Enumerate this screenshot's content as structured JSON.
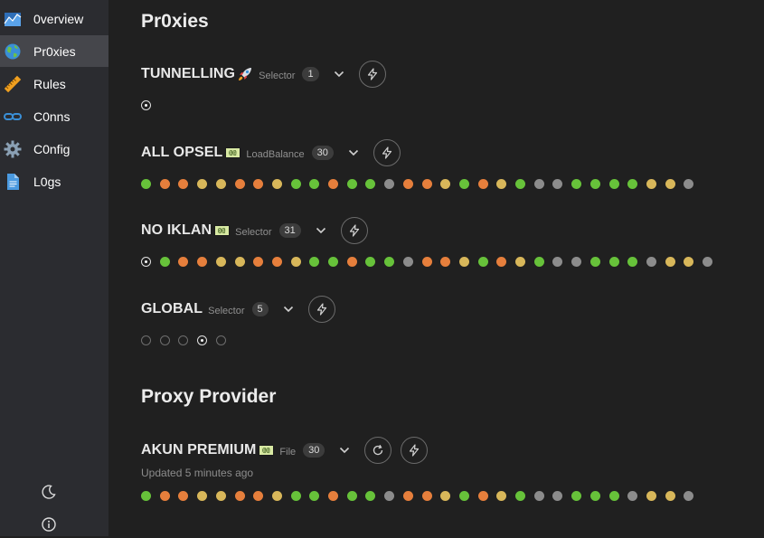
{
  "colors": {
    "green": "#67c23a",
    "orange": "#e67f3c",
    "yellow": "#d8b75a",
    "gray": "#8c8c8c",
    "sidebar_active": "#45464b"
  },
  "sidebar": {
    "items": [
      {
        "label": "0verview",
        "icon": "chart-icon"
      },
      {
        "label": "Pr0xies",
        "icon": "globe-icon",
        "active": true
      },
      {
        "label": "Rules",
        "icon": "ruler-icon"
      },
      {
        "label": "C0nns",
        "icon": "link-icon"
      },
      {
        "label": "C0nfig",
        "icon": "gear-icon"
      },
      {
        "label": "L0gs",
        "icon": "document-icon"
      }
    ],
    "bottom": [
      "moon-icon",
      "info-icon"
    ]
  },
  "main": {
    "title": "Pr0xies",
    "groups": [
      {
        "name": "TUNNELLING",
        "emoji": "rocket-icon",
        "type": "Selector",
        "count": "1",
        "dots": [
          "selected"
        ]
      },
      {
        "name": "ALL OPSEL",
        "emoji": "flag-icon",
        "type": "LoadBalance",
        "count": "30",
        "dots": [
          "g",
          "o",
          "o",
          "y",
          "y",
          "o",
          "o",
          "y",
          "g",
          "g",
          "o",
          "g",
          "g",
          "x",
          "o",
          "o",
          "y",
          "g",
          "o",
          "y",
          "g",
          "x",
          "x",
          "g",
          "g",
          "g",
          "g",
          "y",
          "y",
          "x"
        ]
      },
      {
        "name": "NO IKLAN",
        "emoji": "flag-icon",
        "type": "Selector",
        "count": "31",
        "dots": [
          "selected",
          "g",
          "o",
          "o",
          "y",
          "y",
          "o",
          "o",
          "y",
          "g",
          "g",
          "o",
          "g",
          "g",
          "x",
          "o",
          "o",
          "y",
          "g",
          "o",
          "y",
          "g",
          "x",
          "x",
          "g",
          "g",
          "g",
          "x",
          "y",
          "y",
          "x"
        ]
      },
      {
        "name": "GLOBAL",
        "emoji": "",
        "type": "Selector",
        "count": "5",
        "dots": [
          "empty",
          "empty",
          "empty",
          "selected",
          "empty"
        ]
      }
    ],
    "provider_title": "Proxy Provider",
    "providers": [
      {
        "name": "AKUN PREMIUM",
        "emoji": "flag-icon",
        "type": "File",
        "count": "30",
        "updated": "Updated 5 minutes ago",
        "dots": [
          "g",
          "o",
          "o",
          "y",
          "y",
          "o",
          "o",
          "y",
          "g",
          "g",
          "o",
          "g",
          "g",
          "x",
          "o",
          "o",
          "y",
          "g",
          "o",
          "y",
          "g",
          "x",
          "x",
          "g",
          "g",
          "g",
          "x",
          "y",
          "y",
          "x"
        ]
      }
    ]
  }
}
